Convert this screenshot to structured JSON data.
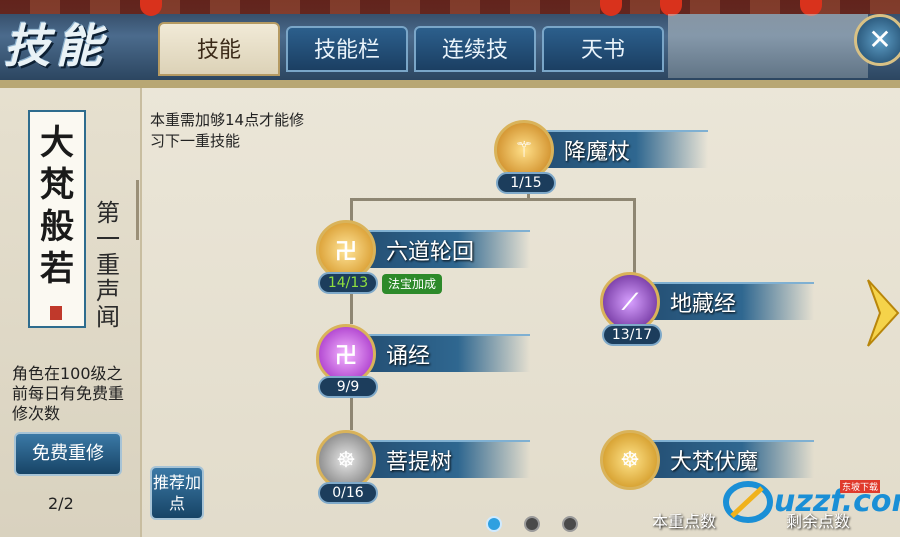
{
  "window": {
    "title": "技能",
    "close_symbol": "✕"
  },
  "tabs": [
    {
      "label": "技能",
      "active": true
    },
    {
      "label": "技能栏",
      "active": false
    },
    {
      "label": "连续技",
      "active": false
    },
    {
      "label": "天书",
      "active": false
    }
  ],
  "sidebar": {
    "scroll_title": "大梵般若",
    "stage_label": "第一重声闻",
    "free_reset_note": "角色在100级之前每日有免费重修次数",
    "free_reset_button": "免费重修",
    "free_reset_count": "2/2"
  },
  "main": {
    "requirement_text": "本重需加够14点才能修习下一重技能",
    "recommend_button": "推荐加点",
    "skills": [
      {
        "id": "xiangmozhang",
        "name": "降魔杖",
        "level": "1/15",
        "icon": "staff-icon",
        "color": "#e0a326"
      },
      {
        "id": "liudaolunhui",
        "name": "六道轮回",
        "level": "14/13",
        "icon": "swastika-wheel-icon",
        "color": "#e7b52e",
        "level_highlight": true,
        "badge": "法宝加成"
      },
      {
        "id": "dizangjing",
        "name": "地藏经",
        "level": "13/17",
        "icon": "purple-slash-icon",
        "color": "#8a3fc0"
      },
      {
        "id": "songjing",
        "name": "诵经",
        "level": "9/9",
        "icon": "swastika-icon",
        "color": "#b23fd0"
      },
      {
        "id": "putishu",
        "name": "菩提树",
        "level": "0/16",
        "icon": "buddha-grey-icon",
        "color": "#8f8f8f"
      },
      {
        "id": "dafanfumo",
        "name": "大梵伏魔",
        "level": "",
        "icon": "buddha-gold-icon",
        "color": "#e2b630"
      }
    ]
  },
  "footer": {
    "current_points_label": "本重点数",
    "remaining_points_label": "剩余点数",
    "pager": {
      "pages": 3,
      "current": 1
    }
  },
  "watermark": {
    "text": "uzzf.com",
    "sub": "东坡下载"
  },
  "colors": {
    "tab_blue": "#1b3f63",
    "panel_bg": "#ebe6d8",
    "accent_gold": "#d9b35a",
    "level_green": "#8fe03e"
  }
}
